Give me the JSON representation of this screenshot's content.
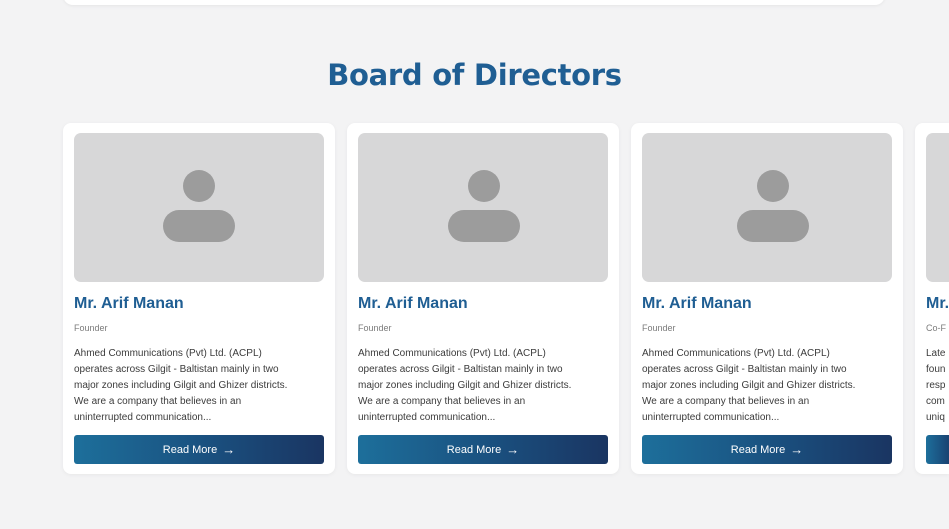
{
  "section": {
    "title": "Board of Directors"
  },
  "read_more_label": "Read More",
  "cards": [
    {
      "name": "Mr. Arif Manan",
      "role": "Founder",
      "description_lines": [
        "Ahmed Communications (Pvt) Ltd. (ACPL)",
        "operates  across Gilgit - Baltistan mainly in two",
        "major zones  including Gilgit and Ghizer districts.",
        "We are a company  that believes in an",
        "uninterrupted communication..."
      ]
    },
    {
      "name": "Mr. Arif Manan",
      "role": "Founder",
      "description_lines": [
        "Ahmed Communications (Pvt) Ltd. (ACPL)",
        "operates  across Gilgit - Baltistan mainly in two",
        "major zones  including Gilgit and Ghizer districts.",
        "We are a company  that believes in an",
        "uninterrupted communication..."
      ]
    },
    {
      "name": "Mr. Arif Manan",
      "role": "Founder",
      "description_lines": [
        "Ahmed Communications (Pvt) Ltd. (ACPL)",
        "operates  across Gilgit - Baltistan mainly in two",
        "major zones  including Gilgit and Ghizer districts.",
        "We are a company  that believes in an",
        "uninterrupted communication..."
      ]
    },
    {
      "name": "Mr.",
      "role": "Co-F",
      "description_lines": [
        "Late",
        "foun",
        "resp",
        "com",
        "uniq"
      ]
    }
  ],
  "icons": {
    "avatar": "person-placeholder-icon",
    "arrow": "arrow-right-icon"
  },
  "colors": {
    "accent": "#1f5e93",
    "button_start": "#1d6f9b",
    "button_end": "#1a3562",
    "background": "#f3f3f4"
  }
}
